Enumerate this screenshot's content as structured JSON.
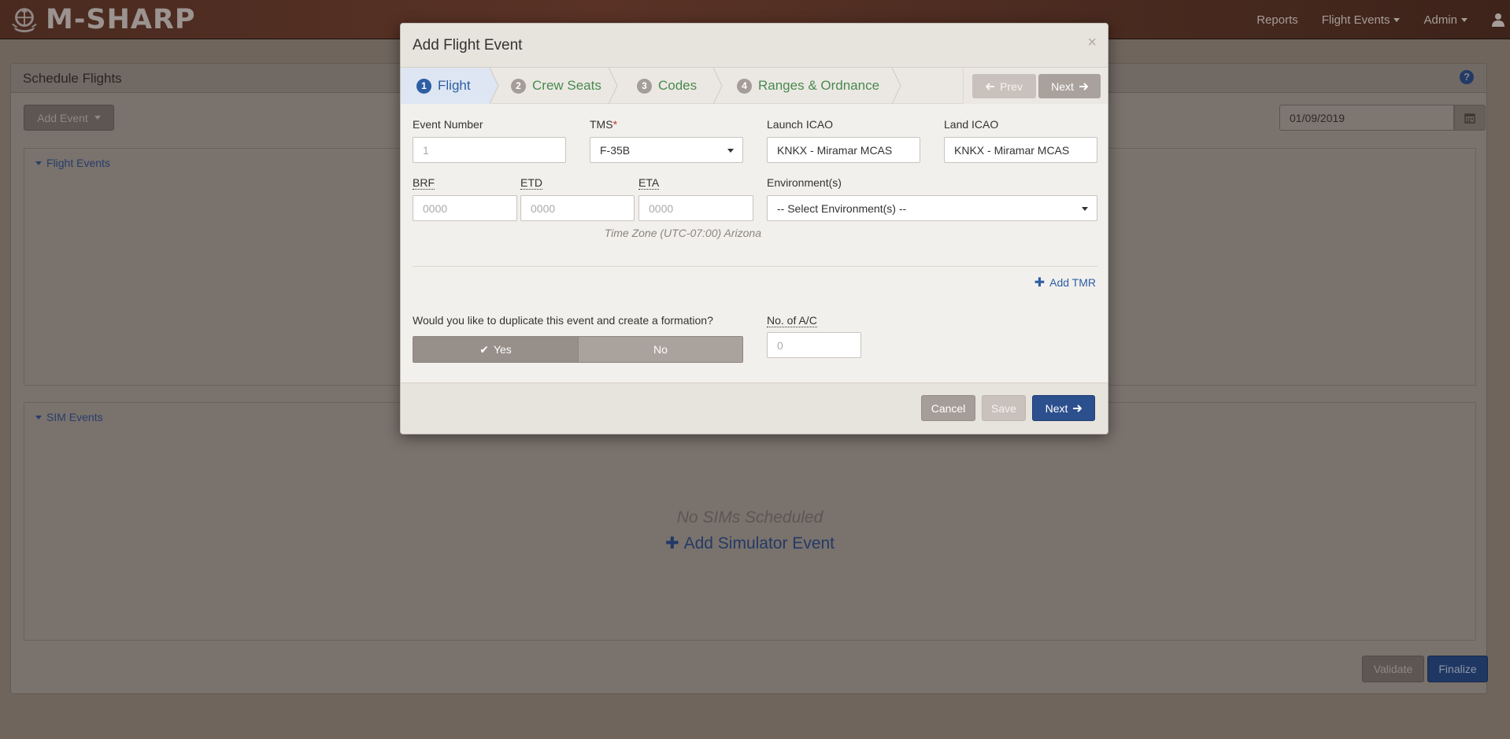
{
  "navbar": {
    "brand": "M-SHARP",
    "links": [
      {
        "label": "Reports",
        "has_caret": false
      },
      {
        "label": "Flight Events",
        "has_caret": true
      },
      {
        "label": "Admin",
        "has_caret": true
      }
    ]
  },
  "page": {
    "title": "Schedule Flights",
    "add_event_label": "Add Event",
    "date_value": "01/09/2019",
    "flight_events_label": "Flight Events",
    "sim_events_label": "SIM Events",
    "no_sims_text": "No SIMs Scheduled",
    "add_sim_label": "Add Simulator Event",
    "validate_label": "Validate",
    "finalize_label": "Finalize"
  },
  "modal": {
    "title": "Add Flight Event",
    "close_symbol": "×",
    "steps": [
      {
        "num": "1",
        "label": "Flight",
        "active": true
      },
      {
        "num": "2",
        "label": "Crew Seats",
        "active": false
      },
      {
        "num": "3",
        "label": "Codes",
        "active": false
      },
      {
        "num": "4",
        "label": "Ranges & Ordnance",
        "active": false
      }
    ],
    "prev_label": "Prev",
    "next_label": "Next",
    "fields": {
      "event_number": {
        "label": "Event Number",
        "placeholder": "1"
      },
      "tms": {
        "label": "TMS",
        "required_mark": "*",
        "value": "F-35B"
      },
      "launch_icao": {
        "label": "Launch ICAO",
        "value": "KNKX - Miramar MCAS"
      },
      "land_icao": {
        "label": "Land ICAO",
        "value": "KNKX - Miramar MCAS"
      },
      "brf": {
        "label": "BRF",
        "placeholder": "0000"
      },
      "etd": {
        "label": "ETD",
        "placeholder": "0000"
      },
      "eta": {
        "label": "ETA",
        "placeholder": "0000"
      },
      "environment": {
        "label": "Environment(s)",
        "value": "-- Select Environment(s) --"
      },
      "timezone_note": "Time Zone (UTC-07:00) Arizona",
      "add_tmr_label": "Add TMR",
      "duplicate_question": "Would you like to duplicate this event and create a formation?",
      "yes_label": "Yes",
      "no_label": "No",
      "num_ac": {
        "label": "No. of A/C",
        "placeholder": "0"
      }
    },
    "footer": {
      "cancel_label": "Cancel",
      "save_label": "Save",
      "next_label": "Next"
    }
  },
  "colors": {
    "primary_blue": "#2c4f8e",
    "step_green": "#4a8a4d",
    "active_step_blue": "#2e5ea3",
    "navbar_brown": "#5a3226"
  }
}
